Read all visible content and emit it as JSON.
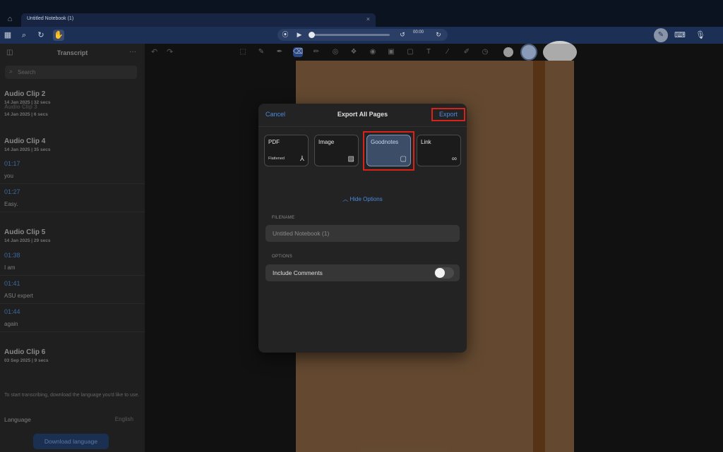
{
  "tabbar": {
    "tab_title": "Untitled Notebook (1)",
    "home_icon": "home-icon",
    "close_icon": "close-icon"
  },
  "toolbar": {
    "left_icons": [
      "grid-icon",
      "search-icon",
      "lasso-icon",
      "hand-icon"
    ],
    "audio": {
      "time": "00:00",
      "icons": [
        "record-icon",
        "play-icon",
        "rewind-icon",
        "forward-icon"
      ]
    },
    "right_icons": [
      "pen-icon",
      "keyboard-icon",
      "microphone-icon"
    ]
  },
  "sidebar": {
    "title": "Transcript",
    "search_placeholder": "Search",
    "clips": [
      {
        "title": "Audio Clip 2",
        "meta": "14 Jan 2025 | 32 secs"
      },
      {
        "title": "Audio Clip 3",
        "meta": "14 Jan 2025 | 6 secs"
      },
      {
        "title": "Audio Clip 4",
        "meta": "14 Jan 2025 | 35 secs",
        "entries": [
          {
            "time": "01:17",
            "text": "you"
          },
          {
            "time": "01:27",
            "text": "Easy."
          }
        ]
      },
      {
        "title": "Audio Clip 5",
        "meta": "14 Jan 2025 | 29 secs",
        "entries": [
          {
            "time": "01:38",
            "text": "I am"
          },
          {
            "time": "01:41",
            "text": "ASU expert"
          },
          {
            "time": "01:44",
            "text": "again"
          }
        ]
      },
      {
        "title": "Audio Clip 6",
        "meta": "03 Sep 2025 | 9 secs"
      }
    ],
    "note": "To start transcribing, download the language you'd like to use.",
    "language_label": "Language",
    "language_value": "English",
    "download_button": "Download language"
  },
  "canvas": {
    "tool_icons": [
      "lasso-icon",
      "pen-icon",
      "fountain-pen-icon",
      "eraser-icon",
      "highlighter-icon",
      "shapes-icon",
      "elements-icon",
      "sticker-icon",
      "image-icon",
      "camera-icon",
      "text-icon",
      "pencil-icon",
      "laser-icon",
      "clock-icon"
    ],
    "colors": [
      "#bdbdbd",
      "#a9bde0",
      "#d0d0d0"
    ]
  },
  "modal": {
    "cancel": "Cancel",
    "title": "Export All Pages",
    "export": "Export",
    "formats": [
      {
        "name": "PDF",
        "sub": "Flattened",
        "icon": "pdf-icon"
      },
      {
        "name": "Image",
        "sub": "",
        "icon": "image-icon"
      },
      {
        "name": "Goodnotes",
        "sub": "",
        "icon": "goodnotes-icon",
        "selected": true
      },
      {
        "name": "Link",
        "sub": "",
        "icon": "link-icon"
      }
    ],
    "hide_options": "Hide Options",
    "filename_label": "FILENAME",
    "filename_value": "Untitled Notebook (1)",
    "options_label": "OPTIONS",
    "include_comments": "Include Comments",
    "include_comments_on": false,
    "highlight_color": "#d8231b",
    "accent_color": "#4b8ae0"
  }
}
